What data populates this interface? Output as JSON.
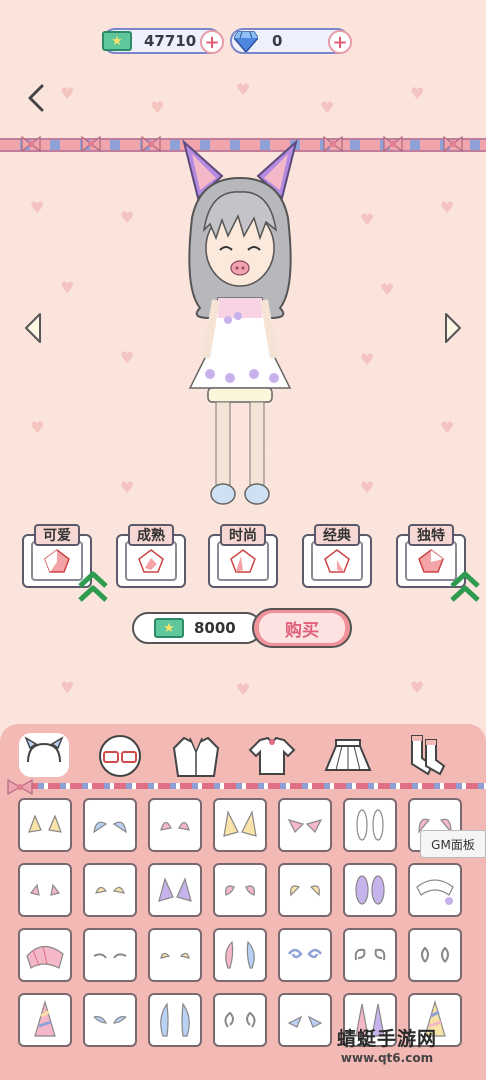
{
  "currency": {
    "cash_value": "47710",
    "gem_value": "0",
    "plus_symbol": "+"
  },
  "styles": [
    {
      "label": "可爱",
      "boosted": true
    },
    {
      "label": "成熟",
      "boosted": false
    },
    {
      "label": "时尚",
      "boosted": false
    },
    {
      "label": "经典",
      "boosted": false
    },
    {
      "label": "独特",
      "boosted": true
    }
  ],
  "purchase": {
    "price": "8000",
    "buy_label": "购买"
  },
  "categories": [
    "ears-icon",
    "glasses-icon",
    "jacket-icon",
    "shirt-icon",
    "skirt-icon",
    "socks-icon"
  ],
  "gm_panel_label": "GM面板",
  "watermark": {
    "name": "蜻蜓手游网",
    "url": "www.qt6.com"
  },
  "colors": {
    "background": "#fbe4dc",
    "panel": "#f3b9b5",
    "cash": "#5ec79c",
    "gem": "#4f86e0",
    "accent_pink": "#f1929a",
    "boost_green": "#2e9b4e"
  }
}
